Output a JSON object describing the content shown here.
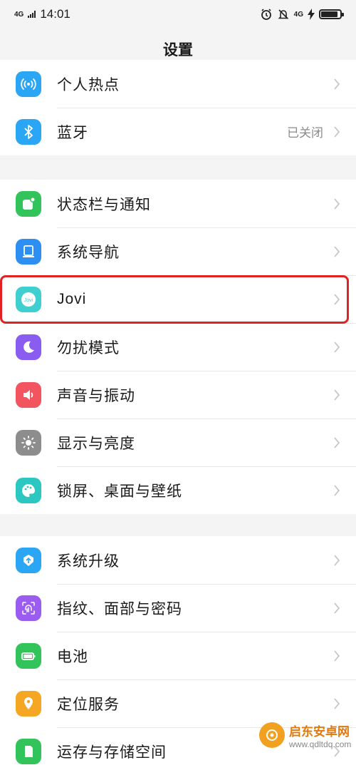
{
  "status_bar": {
    "network_left": "4G",
    "time": "14:01",
    "network_right": "4G",
    "battery_level": 0.9
  },
  "page": {
    "title": "设置"
  },
  "groups": [
    {
      "items": [
        {
          "label": "个人热点",
          "icon": "hotspot-icon",
          "color": "#2aa6f5"
        },
        {
          "label": "蓝牙",
          "value": "已关闭",
          "icon": "bluetooth-icon",
          "color": "#2aa6f5"
        }
      ]
    },
    {
      "items": [
        {
          "label": "状态栏与通知",
          "icon": "notification-icon",
          "color": "#32c35a"
        },
        {
          "label": "系统导航",
          "icon": "navigation-icon",
          "color": "#2d8ff2"
        },
        {
          "label": "Jovi",
          "icon": "jovi-icon",
          "color": "#3fcfd0"
        },
        {
          "label": "勿扰模式",
          "icon": "moon-icon",
          "color": "#8a5cf0"
        },
        {
          "label": "声音与振动",
          "icon": "speaker-icon",
          "color": "#f25560"
        },
        {
          "label": "显示与亮度",
          "icon": "brightness-icon",
          "color": "#8d8d8d"
        },
        {
          "label": "锁屏、桌面与壁纸",
          "icon": "palette-icon",
          "color": "#2bc7c0"
        }
      ]
    },
    {
      "items": [
        {
          "label": "系统升级",
          "icon": "upgrade-icon",
          "color": "#2aa6f5"
        },
        {
          "label": "指纹、面部与密码",
          "icon": "fingerprint-icon",
          "color": "#9b5cf0"
        },
        {
          "label": "电池",
          "icon": "battery-icon",
          "color": "#32c35a"
        },
        {
          "label": "定位服务",
          "icon": "location-icon",
          "color": "#f5a623"
        },
        {
          "label": "运存与存储空间",
          "icon": "storage-icon",
          "color": "#32c35a"
        }
      ]
    }
  ],
  "watermark": {
    "title": "启东安卓网",
    "url": "www.qdltdq.com"
  }
}
